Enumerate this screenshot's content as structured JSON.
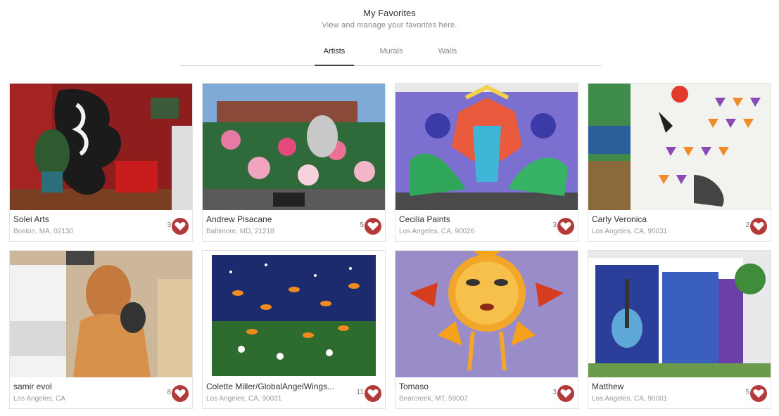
{
  "header": {
    "title": "My Favorites",
    "subtitle": "View and manage your favorites here."
  },
  "tabs": [
    {
      "label": "Artists",
      "active": true
    },
    {
      "label": "Murals",
      "active": false
    },
    {
      "label": "Walls",
      "active": false
    }
  ],
  "accent_color": "#b23a3a",
  "cards": [
    {
      "name": "Solei Arts",
      "location": "Boston, MA, 02130",
      "count": "3"
    },
    {
      "name": "Andrew Pisacane",
      "location": "Baltimore, MD, 21218",
      "count": "5"
    },
    {
      "name": "Cecilia Paints",
      "location": "Los Angeles, CA, 90026",
      "count": "3"
    },
    {
      "name": "Carly Veronica",
      "location": "Los Angeles, CA, 90031",
      "count": "2"
    },
    {
      "name": "samir evol",
      "location": "Los Angeles, CA",
      "count": "8"
    },
    {
      "name": "Colette Miller/GlobalAngelWings...",
      "location": "Los Angeles, CA, 90031",
      "count": "11"
    },
    {
      "name": "Tomaso",
      "location": "Bearcreek, MT, 59007",
      "count": "3"
    },
    {
      "name": "Matthew",
      "location": "Los Angeles, CA, 90001",
      "count": "5"
    }
  ],
  "card_icon": "heart-icon"
}
